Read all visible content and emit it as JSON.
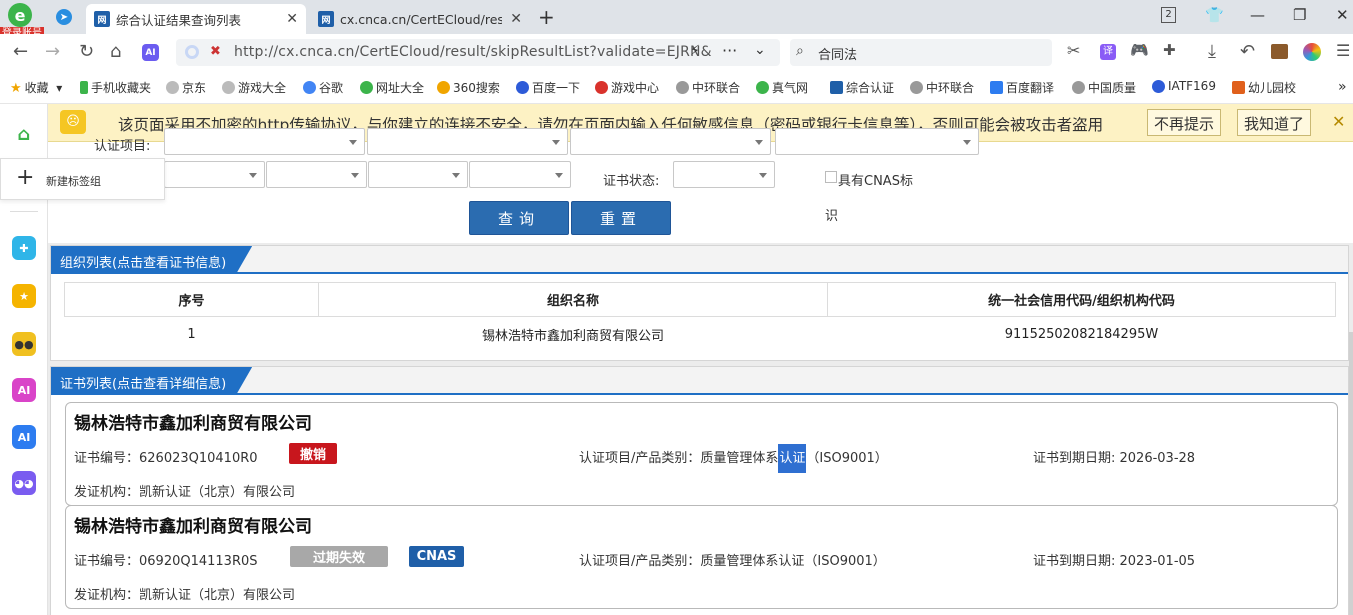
{
  "browser": {
    "account_label": "登录账号",
    "tabs": [
      {
        "label": "综合认证结果查询列表",
        "favicon": "网"
      },
      {
        "label": "cx.cnca.cn/CertECloud/resul",
        "favicon": "网"
      }
    ],
    "tab_count": "2",
    "url": "http://cx.cnca.cn/CertECloud/result/skipResultList?validate=EJRN&",
    "search_text": "合同法",
    "translate_label": "译"
  },
  "bookmarks": [
    "收藏",
    "手机收藏夹",
    "京东",
    "游戏大全",
    "谷歌",
    "网址大全",
    "360搜索",
    "百度一下",
    "游戏中心",
    "中环联合",
    "真气网",
    "综合认证",
    "中环联合",
    "百度翻译",
    "中国质量",
    "IATF169",
    "幼儿园校"
  ],
  "warning": {
    "text": "该页面采用不加密的http传输协议，与你建立的连接不安全，请勿在页面内输入任何敏感信息（密码或银行卡信息等），否则可能会被攻击者盗用",
    "no_remind": "不再提示",
    "got_it": "我知道了"
  },
  "sidebar": {
    "new_group": "新建标签组"
  },
  "form": {
    "cert_project_label": "认证项目:",
    "cert_status_label": "证书状态:",
    "cnas_label": "具有CNAS标",
    "cnas_label2": "识",
    "query_button": "查询",
    "reset_button": "重置"
  },
  "org_panel": {
    "title": "组织列表(点击查看证书信息)",
    "headers": [
      "序号",
      "组织名称",
      "统一社会信用代码/组织机构代码"
    ],
    "rows": [
      {
        "index": "1",
        "name": "锡林浩特市鑫加利商贸有限公司",
        "code": "9115250208218429​5W"
      }
    ]
  },
  "cert_panel": {
    "title": "证书列表(点击查看详细信息)",
    "cards": [
      {
        "company": "锡林浩特市鑫加利商贸有限公司",
        "cert_no": "证书编号：626023Q10410R0",
        "status_badge": "撤销",
        "status_color": "#c8161d",
        "project_prefix": "认证项目/产品类别：质量管理体系",
        "project_highlight": "认证",
        "project_suffix": "（ISO9001）",
        "expiry": "证书到期日期: 2026-03-28",
        "issuer": "发证机构：凯新认证（北京）有限公司"
      },
      {
        "company": "锡林浩特市鑫加利商贸有限公司",
        "cert_no": "证书编号：06920Q14113R0S",
        "status_badge": "过期失效",
        "status_color": "#a8a8a8",
        "cnas_badge": "CNAS",
        "cnas_color": "#1f5fa8",
        "project": "认证项目/产品类别：质量管理体系认证（ISO9001）",
        "expiry": "证书到期日期: 2023-01-05",
        "issuer": "发证机构：凯新认证（北京）有限公司"
      }
    ]
  }
}
